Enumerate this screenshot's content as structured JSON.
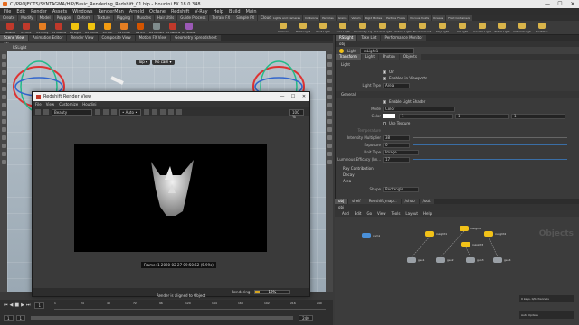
{
  "window": {
    "title": "C:/PROJECTS/SYNTAGMA/HIP/Basic_Rendering_Redshift_01.hip - Houdini FX 18.0.348",
    "controls": [
      "—",
      "☐",
      "✕"
    ]
  },
  "menubar": [
    "File",
    "Edit",
    "Render",
    "Assets",
    "Windows",
    "RenderMan",
    "Arnold",
    "Octane",
    "Redshift",
    "V-Ray",
    "Help",
    "Build",
    "Main"
  ],
  "shelf": {
    "tabs": [
      "Create",
      "Modify",
      "Model",
      "Polygon",
      "Deform",
      "Texture",
      "Rigging",
      "Muscles",
      "Hair Utils",
      "Guide Process",
      "Terrain FX",
      "Simple FX",
      "Cloud FX",
      "Volume"
    ],
    "tools": [
      {
        "label": "Redshift",
        "color": "#c0392b"
      },
      {
        "label": "RS ROP",
        "color": "#c0392b"
      },
      {
        "label": "RS Proxy",
        "color": "#e67e22"
      },
      {
        "label": "RS Volume",
        "color": "#c0392b"
      },
      {
        "label": "RS Light",
        "color": "#f1c40f"
      },
      {
        "label": "RS Dome",
        "color": "#f1c40f"
      },
      {
        "label": "RS Sun",
        "color": "#f39c12"
      },
      {
        "label": "RS Portal",
        "color": "#e67e22"
      },
      {
        "label": "RS IES",
        "color": "#d35400"
      },
      {
        "label": "RS Camera",
        "color": "#7f8c8d"
      },
      {
        "label": "RS Material",
        "color": "#c0392b"
      },
      {
        "label": "RS Shader",
        "color": "#9b59b6"
      }
    ],
    "right_tabs": [
      "Lights and Cameras",
      "Collisions",
      "Particles",
      "Grains",
      "Vellum",
      "Rigid Bodies",
      "Particle Fluids",
      "Viscous Fluids",
      "Oceans",
      "Fluid Containers"
    ],
    "right_tools": [
      "Camera",
      "Point Light",
      "Spot Light",
      "Area Light",
      "Geometry Light",
      "Volume Light",
      "Distant Light",
      "Environment Light",
      "Sky Light",
      "GI Light",
      "Caustic Light",
      "Portal Light",
      "Ambient Light",
      "Switcher"
    ]
  },
  "leftpane": {
    "tabs": [
      "Scene View",
      "Animation Editor",
      "Render View",
      "Composite View",
      "Motion FX View",
      "Geometry Spreadsheet"
    ],
    "path": "obj",
    "viewport_label": "RSLight",
    "display_option": "Object Display",
    "persp": "Top ▾",
    "cam": "No cam ▾",
    "status": "Render is aligned to Object"
  },
  "render_view": {
    "title": "Redshift Render View",
    "menu": [
      "File",
      "View",
      "Customize",
      "Houdini"
    ],
    "display": "Beauty",
    "auto": "• Auto •",
    "zoom": "100 %",
    "caption": "Frame: 1  2020-02-27 09:50:52  (5.99s)",
    "status_label": "Rendering",
    "progress_pct": 12,
    "progress_text": "12%"
  },
  "timeline": {
    "frame": "1",
    "start": "1",
    "end": "240",
    "ticks": [
      "1",
      "24",
      "48",
      "72",
      "96",
      "120",
      "144",
      "168",
      "192",
      "216",
      "240"
    ],
    "auto_update": "Auto Update",
    "keys": "0 keys, 0/0 channels"
  },
  "rightpane": {
    "tabs": [
      "RSLight",
      "Take List",
      "Performance Monitor"
    ],
    "path": "obj",
    "node_type": "Light",
    "node_name": "rsLight1",
    "param_tabs": [
      "Transform",
      "Light",
      "Photon",
      "Objects"
    ],
    "section_light": "Light",
    "on_label": "On",
    "viewport_label": "Enabled in Viewports",
    "type_label": "Light Type",
    "type_value": "Area",
    "section_general": "General",
    "enable_shader": "Enable Light Shader",
    "mode_label": "Mode",
    "mode_value": "Color",
    "color_label": "Color",
    "color_vals": [
      "1",
      "1",
      "1"
    ],
    "use_texture": "Use Texture",
    "temp_label": "Temperature",
    "intensity_label": "Intensity Multiplier",
    "intensity_value": "38",
    "exposure_label": "Exposure",
    "exposure_value": "0",
    "unit_label": "Unit Type",
    "unit_value": "Image",
    "lum_label": "Luminous Efficacy (lm...",
    "lum_value": "17",
    "ray": "Ray Contribution",
    "decay": "Decay",
    "area": "Area",
    "shape_label": "Shape",
    "shape_value": "Rectangle"
  },
  "network": {
    "tabs": [
      "obj",
      "shelf",
      "Redshift_map...",
      "/shop",
      "/out"
    ],
    "path": "obj",
    "menu": [
      "Add",
      "Edit",
      "Go",
      "View",
      "Tools",
      "Layout",
      "Help"
    ],
    "watermark": "Objects",
    "nodes": [
      {
        "label": "cam1",
        "color": "#4a90d9"
      },
      {
        "label": "rsLight1",
        "color": "#f2c218"
      },
      {
        "label": "rsLight2",
        "color": "#f2c218"
      },
      {
        "label": "rsLight3",
        "color": "#f2c218"
      },
      {
        "label": "rsLight4",
        "color": "#f2c218"
      },
      {
        "label": "geo1",
        "color": "#9aa0a6"
      },
      {
        "label": "geo2",
        "color": "#9aa0a6"
      },
      {
        "label": "geo3",
        "color": "#9aa0a6"
      },
      {
        "label": "geo4",
        "color": "#9aa0a6"
      }
    ]
  }
}
